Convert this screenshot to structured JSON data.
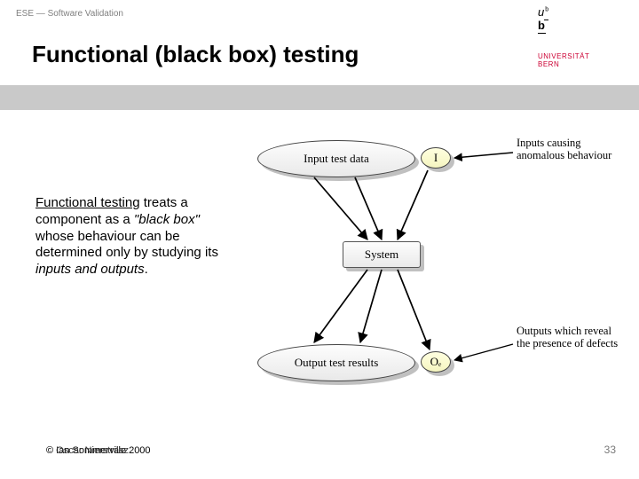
{
  "header": {
    "topline": "ESE — Software Validation",
    "title": "Functional (black box) testing"
  },
  "logo": {
    "u": "u",
    "b": "b",
    "sup": "b",
    "uni_line1": "UNIVERSITÄT",
    "uni_line2": "BERN"
  },
  "description": {
    "lead_underline": "Functional testing",
    "lead_rest": " treats a component as a ",
    "quote_italic": "\"black box\"",
    "mid": " whose behaviour can be determined only by studying its ",
    "io_italic": "inputs and outputs",
    "tail": "."
  },
  "diagram": {
    "input_label": "Input test data",
    "input_small": "I",
    "system_label": "System",
    "output_label": "Output test results",
    "output_small": "Oₑ",
    "ann_top": "Inputs causing anomalous behaviour",
    "ann_bottom": "Outputs which reveal the presence of defects"
  },
  "footer": {
    "copyright_a": "© Ian Sommerville 2000",
    "copyright_b": "© Oscar Nierstrasz",
    "page": "33"
  }
}
